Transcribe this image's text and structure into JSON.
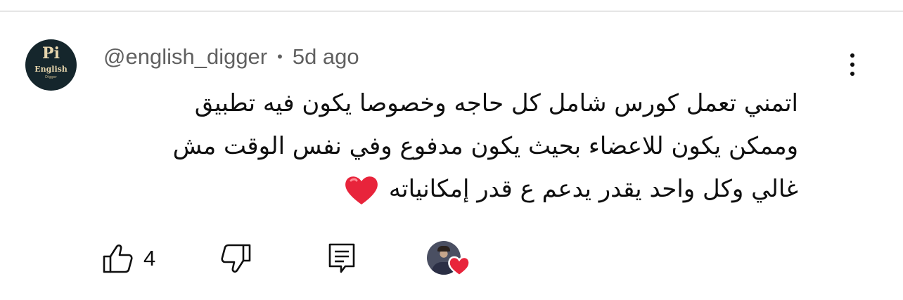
{
  "comment": {
    "author": "@english_digger",
    "separator": "•",
    "age": "5d ago",
    "lines": [
      "اتمني تعمل كورس شامل كل حاجه وخصوصا يكون فيه تطبيق",
      "وممكن يكون للاعضاء بحيث يكون مدفوع وفي نفس الوقت مش",
      "غالي وكل واحد يقدر يدعم ع قدر إمكانياته"
    ],
    "emoji": "❤️",
    "avatar": {
      "monogram": "Pi",
      "brand": "English",
      "brand_sub": "Digger"
    }
  },
  "actions": {
    "like_count": "4",
    "like_icon": "thumbs-up-icon",
    "dislike_icon": "thumbs-down-icon",
    "reply_icon": "reply-comment-icon",
    "more_icon": "more-vertical-icon",
    "creator_heart_icon": "creator-heart-icon"
  },
  "colors": {
    "meta_text": "#606060",
    "body_text": "#0f0f0f",
    "heart": "#e8243b",
    "divider": "#e5e5e5"
  }
}
